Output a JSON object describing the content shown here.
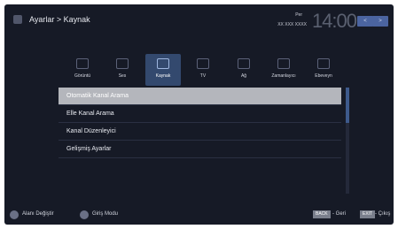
{
  "header": {
    "breadcrumb": "Ayarlar > Kaynak",
    "day": "Per",
    "date": "XX XXX XXXX",
    "time": "14:00",
    "prev_label": "<",
    "next_label": ">"
  },
  "categories": [
    {
      "label": "Görüntü",
      "icon": "picture-icon"
    },
    {
      "label": "Ses",
      "icon": "speaker-icon"
    },
    {
      "label": "Kaynak",
      "icon": "antenna-icon",
      "active": true
    },
    {
      "label": "TV",
      "icon": "tv-icon"
    },
    {
      "label": "Ağ",
      "icon": "network-icon"
    },
    {
      "label": "Zamanlayıcı",
      "icon": "timer-icon"
    },
    {
      "label": "Ebeveyn",
      "icon": "parental-icon"
    }
  ],
  "menu_items": [
    "Otomatik Kanal Arama",
    "Elle Kanal Arama",
    "Kanal Düzenleyici",
    "Gelişmiş Ayarlar"
  ],
  "footer": {
    "nav_label": "Alanı Değiştir",
    "mode_label": "Giriş Modu",
    "back_key": "BACK",
    "back_label": "- Geri",
    "exit_key": "EXIT",
    "exit_label": "- Çıkış"
  },
  "colors": {
    "background": "#161a26",
    "selection": "#b4b6bc",
    "accent": "#4b64a0"
  }
}
